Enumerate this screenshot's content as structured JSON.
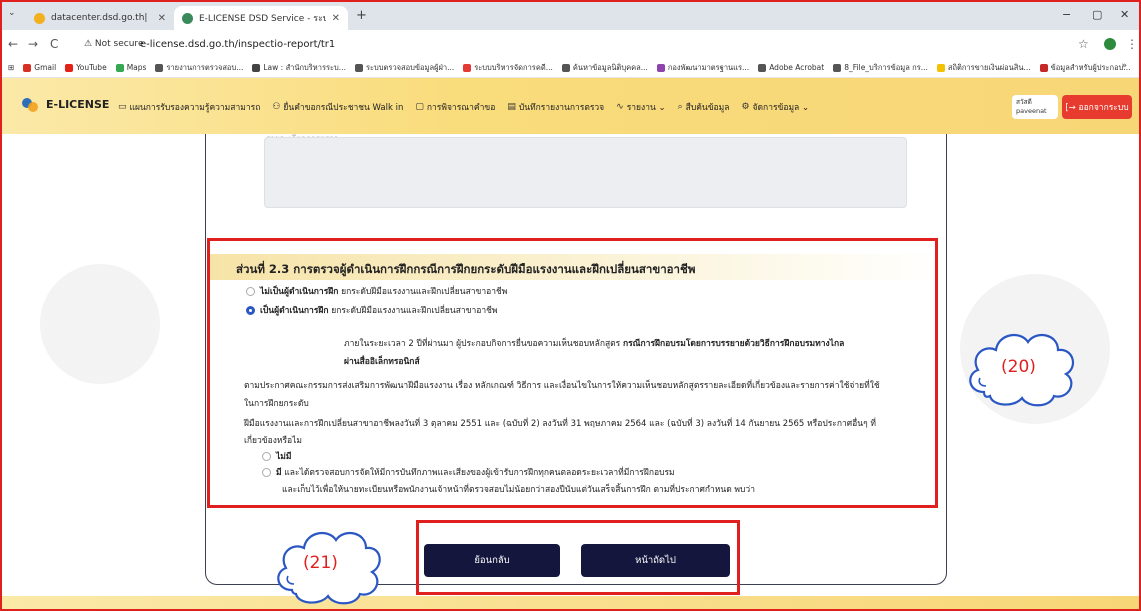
{
  "browser": {
    "tabs": [
      {
        "title": "datacenter.dsd.go.th|",
        "active": false
      },
      {
        "title": "E-LICENSE DSD Service - ระบบใ",
        "active": true
      }
    ],
    "new_tab": "+",
    "window_controls": {
      "minimize": "−",
      "maximize": "▢",
      "close": "✕"
    },
    "nav": {
      "back": "←",
      "forward": "→",
      "reload": "C"
    },
    "security_label": "⚠ Not secure",
    "url": "e-license.dsd.go.th/inspectio-report/tr1",
    "bookmark_star": "☆",
    "kebab": "⋮",
    "bookmarks": [
      {
        "label": "Gmail",
        "color": "#d93025"
      },
      {
        "label": "YouTube",
        "color": "#e62117"
      },
      {
        "label": "Maps",
        "color": "#34a853"
      },
      {
        "label": "รายงานการตรวจสอบ...",
        "color": "#555555"
      },
      {
        "label": "Law : สำนักบริหารระบ...",
        "color": "#444444"
      },
      {
        "label": "ระบบตรวจสอบข้อมูลผู้ฝ่า...",
        "color": "#555555"
      },
      {
        "label": "ระบบบริหารจัดการคดี...",
        "color": "#e53935"
      },
      {
        "label": "ค้นหาข้อมูลนิติบุคคล...",
        "color": "#555555"
      },
      {
        "label": "กองพัฒนามาตรฐานแร...",
        "color": "#8e44ad"
      },
      {
        "label": "Adobe Acrobat",
        "color": "#555555"
      },
      {
        "label": "8_File_บริการข้อมูล กร...",
        "color": "#555555"
      },
      {
        "label": "สถิติการขายเงินผ่อนสิน...",
        "color": "#f2c200"
      },
      {
        "label": "ข้อมูลสำหรับผู้ประกอบ...",
        "color": "#c62828"
      }
    ],
    "bookmarks_more": "»"
  },
  "header": {
    "logo": "E-LICENSE",
    "menu": [
      {
        "icon": "book",
        "label": "แผนการรับรองความรู้ความสามารถ"
      },
      {
        "icon": "walkin",
        "label": "ยื่นคำขอกรณีประชาชน Walk in"
      },
      {
        "icon": "calendar",
        "label": "การพิจารณาคำขอ"
      },
      {
        "icon": "report",
        "label": "บันทึกรายงานการตรวจ"
      },
      {
        "icon": "pulse",
        "label": "รายงาน ⌄"
      },
      {
        "icon": "search",
        "label": "สืบค้นข้อมูล"
      },
      {
        "icon": "gear",
        "label": "จัดการข้อมูล ⌄"
      }
    ],
    "user_greeting": "สวัสดี",
    "user_name": "paveenat",
    "logout": "[→ ออกจากระบบ"
  },
  "form": {
    "field_label": "รายละเอียดการตรวจ",
    "textarea_value": "",
    "section_title": "ส่วนที่ 2.3 การตรวจผู้ดำเนินการฝึกกรณีการฝึกยกระดับฝีมือแรงงานและฝึกเปลี่ยนสาขาอาชีพ",
    "option1_bold": "ไม่เป็นผู้ดำเนินการฝึก",
    "option1_rest": " ยกระดับฝีมือแรงงานและฝึกเปลี่ยนสาขาอาชีพ",
    "option2_bold": "เป็นผู้ดำเนินการฝึก",
    "option2_rest": " ยกระดับฝีมือแรงงานและฝึกเปลี่ยนสาขาอาชีพ",
    "selected_option": 2,
    "para1_line1_normal": "ภายในระยะเวลา 2 ปีที่ผ่านมา ผู้ประกอบกิจการยื่นขอความเห็นชอบหลักสูตร ",
    "para1_line1_bold": "กรณีการฝึกอบรมโดยการบรรยายด้วยวิธีการฝึกอบรมทางไกล",
    "para1_line2_bold": "ผ่านสื่ออิเล็กทรอนิกส์",
    "para2_line1": "ตามประกาศคณะกรรมการส่งเสริมการพัฒนาฝีมือแรงงาน เรื่อง หลักเกณฑ์ วิธีการ และเงื่อนไขในการให้ความเห็นชอบหลักสูตรรายละเอียดที่เกี่ยวข้องและรายการค่าใช้จ่ายที่ใช้",
    "para2_line2": "ในการฝึกยกระดับ",
    "para3_line1": "ฝีมือแรงงานและการฝึกเปลี่ยนสาขาอาชีพลงวันที่ 3 ตุลาคม 2551 และ (ฉบับที่ 2) ลงวันที่ 31 พฤษภาคม 2564 และ (ฉบับที่ 3) ลงวันที่ 14 กันยายน 2565 หรือประกาศอื่นๆ ที่",
    "para3_line2": "เกี่ยวข้องหรือไม",
    "sub_option1": "ไม่มี",
    "sub_option2_bold": "มี",
    "sub_option2_rest": " และได้ตรวจสอบการจัดให้มีการบันทึกภาพและเสียงของผู้เข้ารับการฝึกทุกคนตลอดระยะเวลาที่มีการฝึกอบรม",
    "sub_option2_line2": "และเก็บไว้เพื่อให้นายทะเบียนหรือพนักงานเจ้าหน้าที่ตรวจสอบไม่น้อยกว่าสองปีนับแต่วันเสร็จสิ้นการฝึก ตามที่ประกาศกำหนด พบว่า",
    "back_button": "ย้อนกลับ",
    "next_button": "หน้าถัดไป"
  },
  "annotations": {
    "callout_20": "(20)",
    "callout_21": "(21)",
    "color": "#e0201e"
  }
}
